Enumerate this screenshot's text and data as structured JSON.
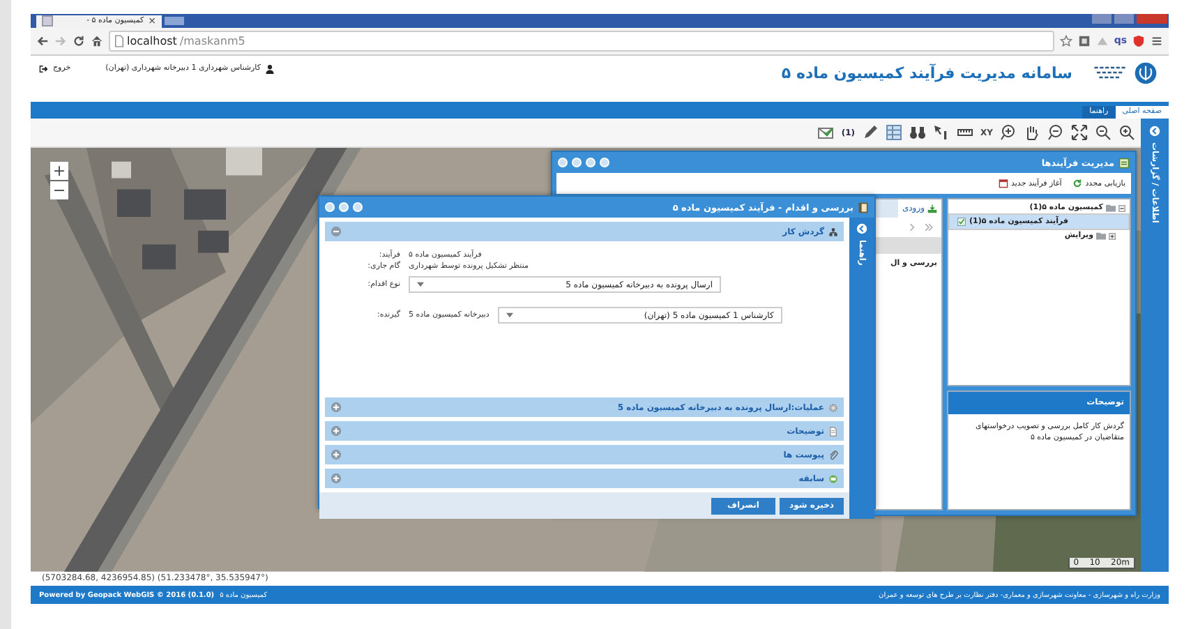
{
  "browser": {
    "tab_title": "کمیسیون ماده ۵ -",
    "tab_close": "×",
    "url_host": "localhost",
    "url_path": "/maskanm5",
    "extension": "qs"
  },
  "header": {
    "title": "سامانه مدیریت فرآیند کمیسیون ماده ۵",
    "user": "کارشناس شهرداری 1 دبیرخانه شهرداری (تهران)",
    "logout": "خروج"
  },
  "nav_tabs": [
    {
      "label": "صفحه اصلی",
      "selected": true
    },
    {
      "label": "راهنما",
      "selected": false
    }
  ],
  "toolbar": {
    "message_count": "(1)",
    "xy_label": "XY"
  },
  "map": {
    "zoom_in": "+",
    "zoom_out": "−",
    "scale_label": "0    10    20m"
  },
  "side_panel": {
    "title": "اطلاعات / گزارشات"
  },
  "process_window": {
    "title": "مدیریت فرآیندها",
    "actions": [
      "بازیابی مجدد",
      "آغاز فرآیند جدید"
    ],
    "tree": [
      {
        "label": "کمیسیون ماده ۵(1)",
        "expanded": true,
        "selected": false,
        "children": [
          {
            "label": "فرآیند کمیسیون ماده ۵(1)",
            "selected": true
          },
          {
            "label": "ویرایش",
            "expanded": false,
            "selected": false
          }
        ]
      }
    ],
    "list_tab": "ورودی",
    "list_cell": "بررسی و ال",
    "description": {
      "title": "توضیحات",
      "text": "گردش کار کامل بررسی و تصویب درخواستهای متقاضیان در کمیسیون ماده ۵"
    }
  },
  "review_window": {
    "title": "بررسی و اقدام - فرآیند کمیسیون ماده ۵",
    "side_strip": "راهنما",
    "panels": [
      {
        "title": "گردش کار",
        "expanded": true
      },
      {
        "title": "عملیات:ارسال پرونده به دبیرخانه کمیسیون ماده 5",
        "expanded": false
      },
      {
        "title": "توضیحات",
        "expanded": false
      },
      {
        "title": "پیوست ها",
        "expanded": false
      },
      {
        "title": "سابقه",
        "expanded": false
      }
    ],
    "fields": [
      {
        "kind": "text",
        "label": "فرآیند:",
        "value": "فرآیند کمیسیون ماده ۵"
      },
      {
        "kind": "text",
        "label": "گام جاری:",
        "value": "منتظر تشکیل پرونده توسط شهرداری"
      },
      {
        "kind": "select",
        "label": "نوع اقدام:",
        "value": "ارسال پرونده به دبیرخانه کمیسیون ماده 5"
      },
      {
        "kind": "select",
        "label": "گیرنده:",
        "prefix": "دبیرخانه کمیسیون ماده 5",
        "value": "کارشناس 1 کمیسیون ماده 5 (تهران)"
      }
    ],
    "buttons": [
      "ذخیره شود",
      "انصراف"
    ]
  },
  "coordinates": "(5703284.68, 4236954.85) (51.233478°, 35.535947°)",
  "footer": {
    "powered": "Powered by  Geopack WebGIS  © 2016 (0.1.0)",
    "app": "کمیسیون ماده ۵",
    "ministry": "وزارت راه و شهرسازی - معاونت شهرسازی و معماری- دفتر نظارت بر طرح های توسعه و عمران"
  }
}
